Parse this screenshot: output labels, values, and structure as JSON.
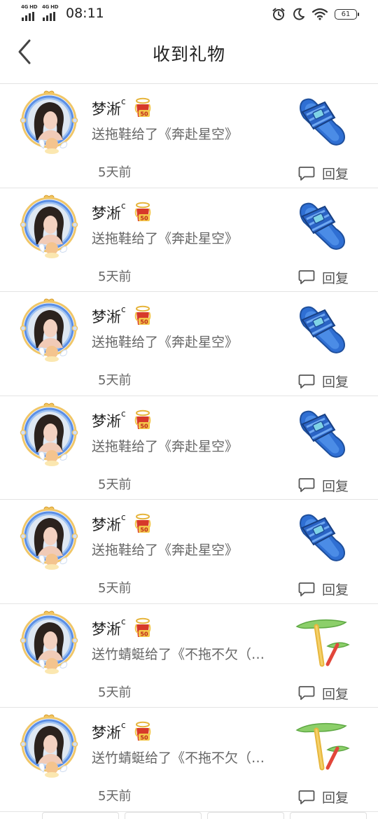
{
  "status_bar": {
    "network_1": "4G HD",
    "network_2": "4G HD",
    "time": "08:11",
    "battery": "61",
    "icons": [
      "alarm-icon",
      "moon-icon",
      "wifi-icon",
      "battery-icon"
    ]
  },
  "header": {
    "title": "收到礼物",
    "back_icon": "chevron-left-icon"
  },
  "reply_label": "回复",
  "gifts": [
    {
      "name": "梦淅",
      "name_suffix": "c",
      "desc": "送拖鞋给了《奔赴星空》",
      "time": "5天前",
      "gift_type": "slipper"
    },
    {
      "name": "梦淅",
      "name_suffix": "c",
      "desc": "送拖鞋给了《奔赴星空》",
      "time": "5天前",
      "gift_type": "slipper"
    },
    {
      "name": "梦淅",
      "name_suffix": "c",
      "desc": "送拖鞋给了《奔赴星空》",
      "time": "5天前",
      "gift_type": "slipper"
    },
    {
      "name": "梦淅",
      "name_suffix": "c",
      "desc": "送拖鞋给了《奔赴星空》",
      "time": "5天前",
      "gift_type": "slipper"
    },
    {
      "name": "梦淅",
      "name_suffix": "c",
      "desc": "送拖鞋给了《奔赴星空》",
      "time": "5天前",
      "gift_type": "slipper"
    },
    {
      "name": "梦淅",
      "name_suffix": "c",
      "desc": "送竹蜻蜓给了《不拖不欠（…",
      "time": "5天前",
      "gift_type": "bamboo-dragonfly"
    },
    {
      "name": "梦淅",
      "name_suffix": "c",
      "desc": "送竹蜻蜓给了《不拖不欠（…",
      "time": "5天前",
      "gift_type": "bamboo-dragonfly"
    }
  ],
  "colors": {
    "text_primary": "#222222",
    "text_secondary": "#666666",
    "divider": "#e4e4e4",
    "avatar_frame": "#5b8fe6",
    "slipper": "#2f6fd3",
    "dragonfly_wing": "#8ccf6a"
  }
}
